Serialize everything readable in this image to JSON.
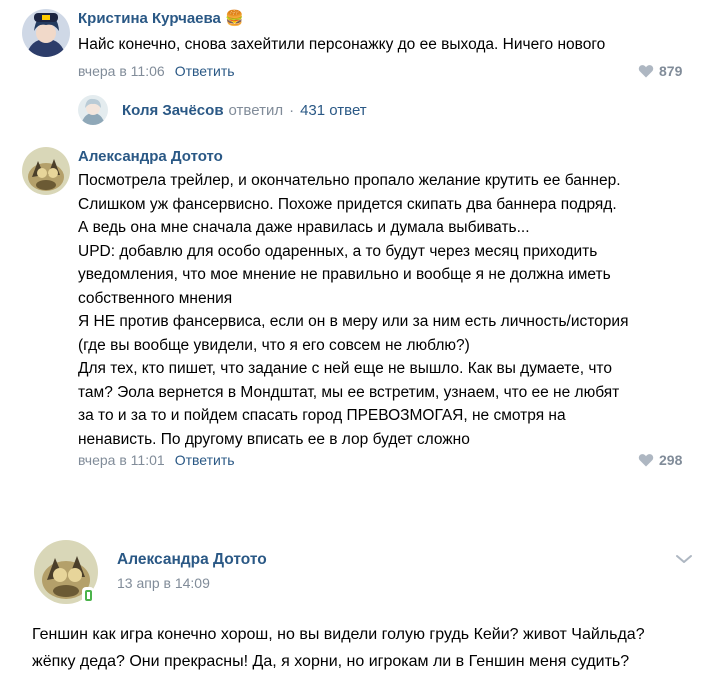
{
  "comment1": {
    "author": "Кристина Курчаева",
    "emoji": "🍔",
    "text": "Найс конечно, снова захейтили персонажку до ее выхода. Ничего нового",
    "date": "вчера в 11:06",
    "reply_label": "Ответить",
    "likes": "879",
    "thread": {
      "author": "Коля Зачёсов",
      "verb": "ответил",
      "separator": "·",
      "count": "431 ответ"
    }
  },
  "comment2": {
    "author": "Александра Дотото",
    "lines": [
      "Посмотрела трейлер, и окончательно пропало желание крутить ее баннер.",
      "Слишком уж фансервисно. Похоже придется скипать два баннера подряд.",
      "А ведь она мне сначала даже нравилась и думала выбивать...",
      "UPD: добавлю для особо одаренных, а то будут через месяц приходить",
      "уведомления, что мое мнение не правильно и вообще я не должна иметь",
      "собственного мнения",
      "Я НЕ против фансервиса, если он в меру или за ним есть личность/история",
      "(где вы вообще увидели, что я его совсем не люблю?)",
      "Для тех, кто пишет, что задание с ней еще не вышло. Как вы думаете, что",
      "там? Эола вернется в Мондштат, мы ее встретим, узнаем, что ее не любят",
      "за то и за то и пойдем спасать город ПРЕВОЗМОГАЯ, не смотря на",
      "ненависть. По другому вписать ее в лор будет сложно"
    ],
    "date": "вчера в 11:01",
    "reply_label": "Ответить",
    "likes": "298"
  },
  "post": {
    "author": "Александра Дотото",
    "date": "13 апр в 14:09",
    "lines": [
      "Геншин как игра конечно хорош, но вы видели голую грудь Кейи? живот Чайльда?",
      "жёпку деда? Они прекрасны! Да, я хорни, но игрокам ли в Геншин меня судить?"
    ]
  },
  "colors": {
    "link": "#2a5885",
    "meta": "#818c99",
    "online": "#4bb34b"
  },
  "icons": {
    "like": "heart-icon",
    "expand": "chevron-down-icon",
    "online": "mobile-online-icon"
  }
}
